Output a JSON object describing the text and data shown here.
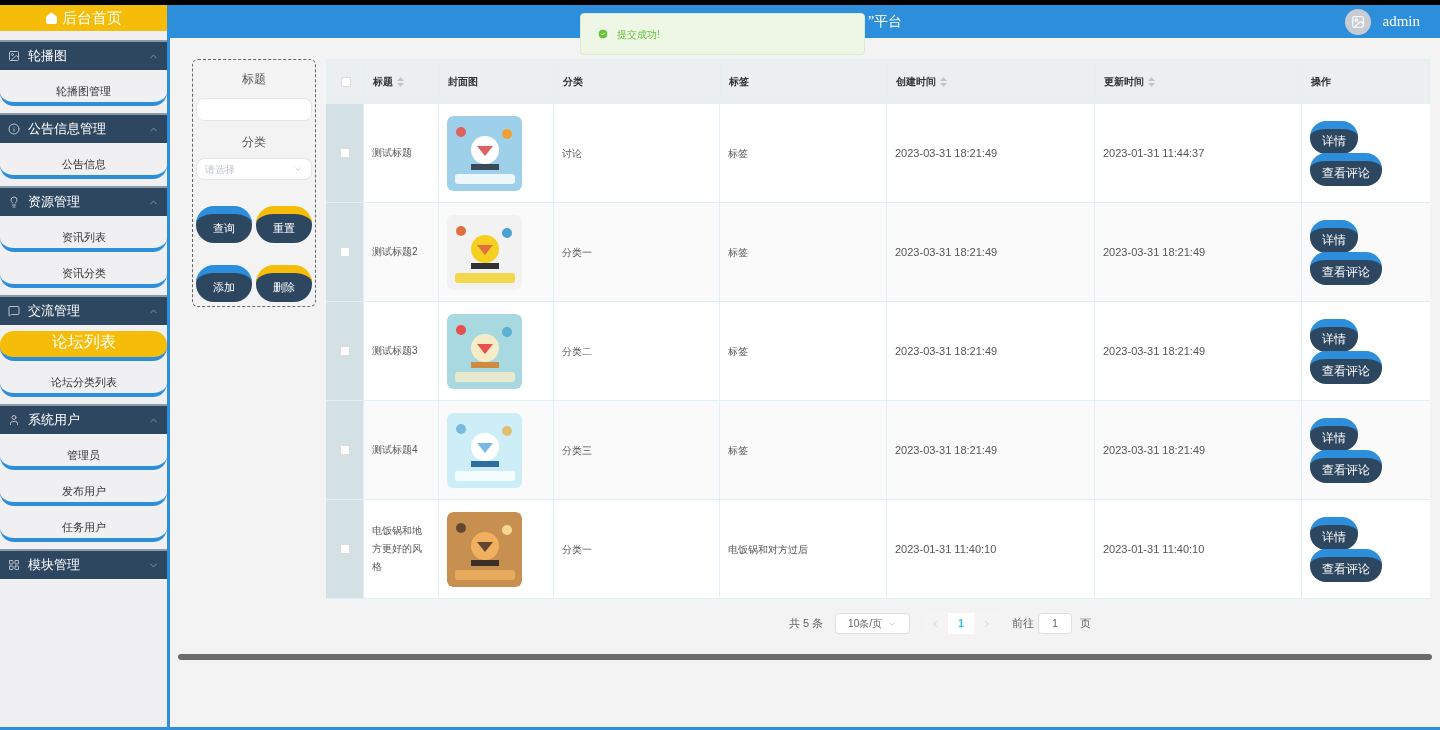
{
  "sidebar": {
    "home": "后台首页",
    "groups": [
      {
        "title": "轮播图",
        "expanded": true,
        "items": [
          {
            "label": "轮播图管理",
            "selected": false
          }
        ]
      },
      {
        "title": "公告信息管理",
        "expanded": true,
        "items": [
          {
            "label": "公告信息",
            "selected": false
          }
        ]
      },
      {
        "title": "资源管理",
        "expanded": true,
        "items": [
          {
            "label": "资讯列表",
            "selected": false
          },
          {
            "label": "资讯分类",
            "selected": false
          }
        ]
      },
      {
        "title": "交流管理",
        "expanded": true,
        "items": [
          {
            "label": "论坛列表",
            "selected": true
          },
          {
            "label": "论坛分类列表",
            "selected": false
          }
        ]
      },
      {
        "title": "系统用户",
        "expanded": true,
        "items": [
          {
            "label": "管理员",
            "selected": false
          },
          {
            "label": "发布用户",
            "selected": false
          },
          {
            "label": "任务用户",
            "selected": false
          }
        ]
      },
      {
        "title": "模块管理",
        "expanded": false
      }
    ]
  },
  "header": {
    "title": "”平台",
    "user": "admin"
  },
  "toast": {
    "message": "提交成功!"
  },
  "filters": {
    "title_label": "标题",
    "category_label": "分类",
    "category_placeholder": "请选择",
    "buttons": [
      "查询",
      "重置",
      "添加",
      "删除"
    ]
  },
  "table": {
    "all_checked": false,
    "columns": [
      {
        "label": "标题",
        "sortable": true
      },
      {
        "label": "封面图",
        "sortable": false
      },
      {
        "label": "分类",
        "sortable": false
      },
      {
        "label": "标签",
        "sortable": false
      },
      {
        "label": "创建时间",
        "sortable": true
      },
      {
        "label": "更新时间",
        "sortable": true
      },
      {
        "label": "操作",
        "sortable": false
      }
    ],
    "rows": [
      {
        "checked": false,
        "title": "测试标题",
        "category": "讨论",
        "tag": "标签",
        "created": "2023-03-31 18:21:49",
        "updated": "2023-01-31 11:44:37",
        "actions": [
          "详情",
          "查看评论"
        ]
      },
      {
        "checked": false,
        "title": "测试标题2",
        "category": "分类一",
        "tag": "标签",
        "created": "2023-03-31 18:21:49",
        "updated": "2023-03-31 18:21:49",
        "actions": [
          "详情",
          "查看评论"
        ]
      },
      {
        "checked": false,
        "title": "测试标题3",
        "category": "分类二",
        "tag": "标签",
        "created": "2023-03-31 18:21:49",
        "updated": "2023-03-31 18:21:49",
        "actions": [
          "详情",
          "查看评论"
        ]
      },
      {
        "checked": false,
        "title": "测试标题4",
        "category": "分类三",
        "tag": "标签",
        "created": "2023-03-31 18:21:49",
        "updated": "2023-03-31 18:21:49",
        "actions": [
          "详情",
          "查看评论"
        ]
      },
      {
        "checked": false,
        "title": "电饭锅和地方更好的风格",
        "category": "分类一",
        "tag": "电饭锅和对方过后",
        "created": "2023-01-31 11:40:10",
        "updated": "2023-01-31 11:40:10",
        "actions": [
          "详情",
          "查看评论"
        ]
      }
    ]
  },
  "pagination": {
    "total": "共 5 条",
    "page_size": "10条/页",
    "pages": [
      {
        "label": "1",
        "selected": true
      }
    ],
    "goto_label": "前往",
    "goto_value": "1",
    "goto_suffix": "页"
  }
}
